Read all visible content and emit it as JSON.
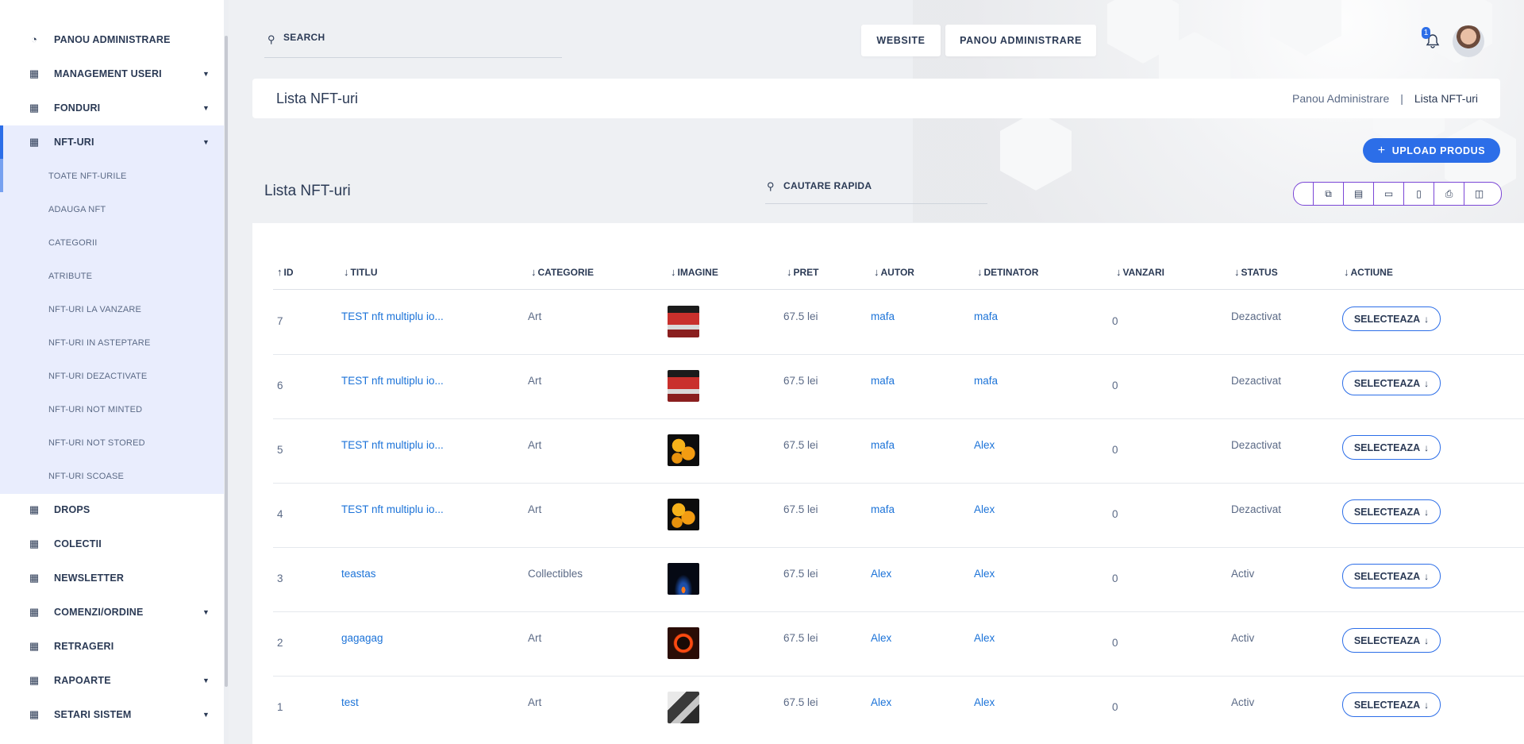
{
  "sidebar": {
    "items": [
      {
        "label": "PANOU ADMINISTRARE",
        "icon": "dashboard-icon"
      },
      {
        "label": "MANAGEMENT USERI",
        "icon": "grid-icon",
        "chevron": true
      },
      {
        "label": "FONDURI",
        "icon": "grid-icon",
        "chevron": true
      },
      {
        "label": "NFT-URI",
        "icon": "grid-icon",
        "chevron": true,
        "active": true
      },
      {
        "label": "DROPS",
        "icon": "grid-icon"
      },
      {
        "label": "COLECTII",
        "icon": "grid-icon"
      },
      {
        "label": "NEWSLETTER",
        "icon": "grid-icon"
      },
      {
        "label": "COMENZI/ORDINE",
        "icon": "grid-icon",
        "chevron": true
      },
      {
        "label": "RETRAGERI",
        "icon": "grid-icon"
      },
      {
        "label": "RAPOARTE",
        "icon": "grid-icon",
        "chevron": true
      },
      {
        "label": "SETARI SISTEM",
        "icon": "grid-icon",
        "chevron": true
      }
    ],
    "submenu": [
      "TOATE NFT-URILE",
      "ADAUGA NFT",
      "CATEGORII",
      "ATRIBUTE",
      "NFT-URI LA VANZARE",
      "NFT-URI IN ASTEPTARE",
      "NFT-URI DEZACTIVATE",
      "NFT-URI NOT MINTED",
      "NFT-URI NOT STORED",
      "NFT-URI SCOASE"
    ]
  },
  "header": {
    "search_label": "SEARCH",
    "website_label": "WEBSITE",
    "admin_label": "PANOU ADMINISTRARE",
    "notification_count": "1"
  },
  "page": {
    "title": "Lista NFT-uri",
    "breadcrumb_root": "Panou Administrare",
    "breadcrumb_sep": "|",
    "breadcrumb_current": "Lista NFT-uri",
    "upload_label": "UPLOAD PRODUS",
    "list_title": "Lista NFT-uri",
    "quick_search": "CAUTARE RAPIDA",
    "export_buttons": [
      "copy-icon",
      "excel-icon",
      "csv-icon",
      "pdf-icon",
      "print-icon",
      "columns-icon"
    ]
  },
  "table": {
    "columns": [
      {
        "label": "ID",
        "arrow": "↑"
      },
      {
        "label": "TITLU",
        "arrow": "↓"
      },
      {
        "label": "CATEGORIE",
        "arrow": "↓"
      },
      {
        "label": "IMAGINE",
        "arrow": "↓"
      },
      {
        "label": "PRET",
        "arrow": "↓"
      },
      {
        "label": "AUTOR",
        "arrow": "↓"
      },
      {
        "label": "DETINATOR",
        "arrow": "↓"
      },
      {
        "label": "VANZARI",
        "arrow": "↓"
      },
      {
        "label": "STATUS",
        "arrow": "↓"
      },
      {
        "label": "ACTIUNE",
        "arrow": "↓"
      }
    ],
    "rows": [
      {
        "id": "7",
        "title": "TEST nft multiplu io...",
        "category": "Art",
        "image": "poster",
        "price": "67.5 lei",
        "author": "mafa",
        "owner": "mafa",
        "sales": "0",
        "status": "Dezactivat",
        "action": "SELECTEAZA"
      },
      {
        "id": "6",
        "title": "TEST nft multiplu io...",
        "category": "Art",
        "image": "poster",
        "price": "67.5 lei",
        "author": "mafa",
        "owner": "mafa",
        "sales": "0",
        "status": "Dezactivat",
        "action": "SELECTEAZA"
      },
      {
        "id": "5",
        "title": "TEST nft multiplu io...",
        "category": "Art",
        "image": "coins",
        "price": "67.5 lei",
        "author": "mafa",
        "owner": "Alex",
        "sales": "0",
        "status": "Dezactivat",
        "action": "SELECTEAZA"
      },
      {
        "id": "4",
        "title": "TEST nft multiplu io...",
        "category": "Art",
        "image": "coins",
        "price": "67.5 lei",
        "author": "mafa",
        "owner": "Alex",
        "sales": "0",
        "status": "Dezactivat",
        "action": "SELECTEAZA"
      },
      {
        "id": "3",
        "title": "teastas",
        "category": "Collectibles",
        "image": "planet",
        "price": "67.5 lei",
        "author": "Alex",
        "owner": "Alex",
        "sales": "0",
        "status": "Activ",
        "action": "SELECTEAZA"
      },
      {
        "id": "2",
        "title": "gagagag",
        "category": "Art",
        "image": "ring",
        "price": "67.5 lei",
        "author": "Alex",
        "owner": "Alex",
        "sales": "0",
        "status": "Activ",
        "action": "SELECTEAZA"
      },
      {
        "id": "1",
        "title": "test",
        "category": "Art",
        "image": "cameras",
        "price": "67.5 lei",
        "author": "Alex",
        "owner": "Alex",
        "sales": "0",
        "status": "Activ",
        "action": "SELECTEAZA"
      }
    ]
  },
  "colors": {
    "accent": "#2c6ee8",
    "link": "#1c73d8",
    "export_border": "#7b47d6"
  }
}
